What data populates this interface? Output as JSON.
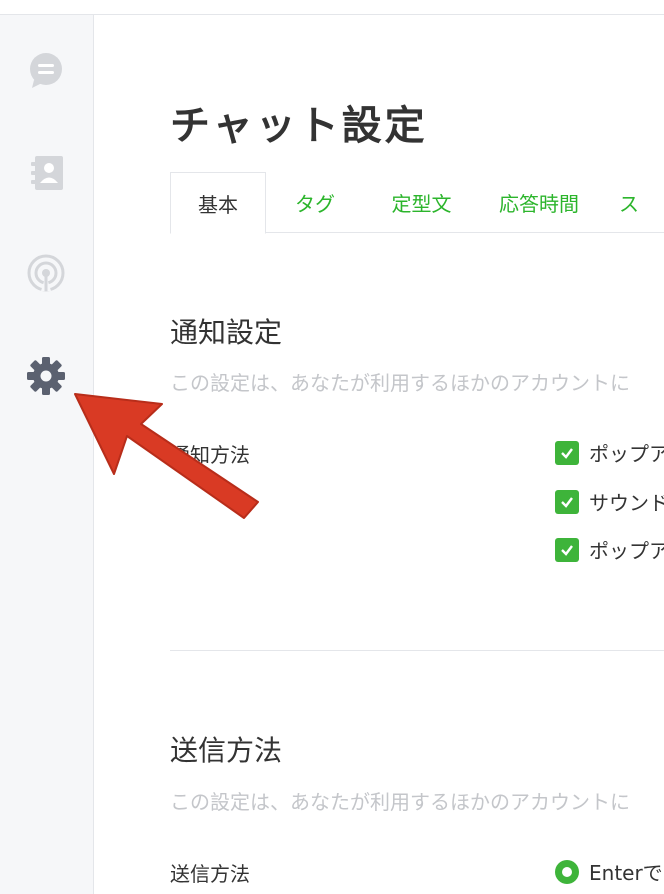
{
  "sidebar": {
    "items": [
      {
        "name": "chats",
        "icon": "chat-bubble-icon"
      },
      {
        "name": "contacts",
        "icon": "contact-book-icon"
      },
      {
        "name": "broadcast",
        "icon": "broadcast-icon"
      },
      {
        "name": "settings",
        "icon": "gear-icon"
      }
    ]
  },
  "page": {
    "title": "チャット設定"
  },
  "tabs": [
    {
      "label": "基本",
      "active": true
    },
    {
      "label": "タグ"
    },
    {
      "label": "定型文"
    },
    {
      "label": "応答時間"
    },
    {
      "label": "ス"
    }
  ],
  "notification_section": {
    "title": "通知設定",
    "description": "この設定は、あなたが利用するほかのアカウントに",
    "field_label": "通知方法",
    "options": [
      {
        "label": "ポップア",
        "checked": true
      },
      {
        "label": "サウンド",
        "checked": true
      },
      {
        "label": "ポップア",
        "checked": true
      }
    ]
  },
  "send_section": {
    "title": "送信方法",
    "description": "この設定は、あなたが利用するほかのアカウントに",
    "field_label": "送信方法",
    "option": {
      "label": "Enterで",
      "selected": true
    }
  },
  "colors": {
    "accent": "#3eb43a",
    "tab_link": "#2cb52c",
    "sidebar_icon": "#d4d6da",
    "sidebar_icon_active": "#5b6170",
    "annotation_arrow": "#d93a24"
  }
}
